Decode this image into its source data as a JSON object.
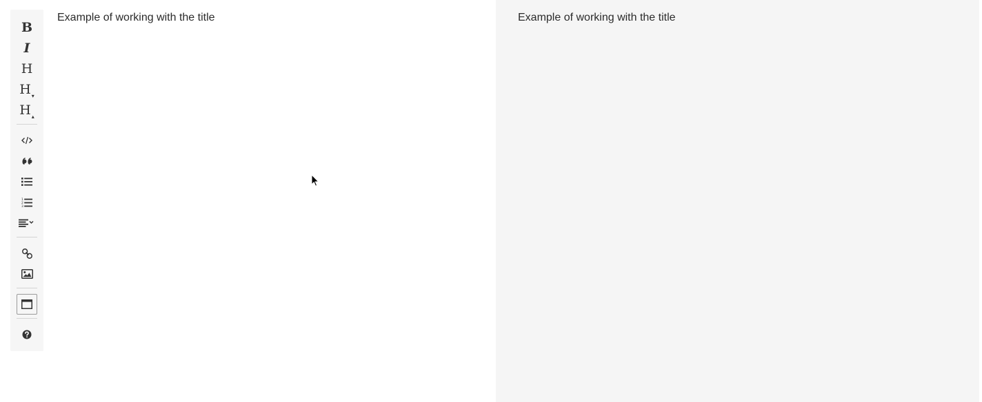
{
  "toolbar": {
    "bold": {
      "label": "B",
      "icon": "bold-icon"
    },
    "italic": {
      "label": "I",
      "icon": "italic-icon"
    },
    "heading": {
      "label": "H",
      "icon": "heading-icon"
    },
    "heading_smaller": {
      "label": "H",
      "suffix": "▾",
      "icon": "heading-smaller-icon"
    },
    "heading_bigger": {
      "label": "H",
      "suffix": "▴",
      "icon": "heading-bigger-icon"
    },
    "code": {
      "icon": "code-icon"
    },
    "quote": {
      "icon": "quote-icon"
    },
    "unordered_list": {
      "icon": "unordered-list-icon"
    },
    "ordered_list": {
      "icon": "ordered-list-icon"
    },
    "align": {
      "icon": "align-dropdown-icon"
    },
    "link": {
      "icon": "link-icon"
    },
    "image": {
      "icon": "image-icon"
    },
    "side_by_side": {
      "icon": "side-by-side-icon",
      "active": true
    },
    "help": {
      "icon": "help-icon"
    }
  },
  "editor": {
    "content": "Example of working with the title"
  },
  "preview": {
    "content": "Example of working with the title"
  },
  "colors": {
    "toolbar_bg": "#f6f6f6",
    "editor_bg": "#ffffff",
    "preview_bg": "#f5f5f5",
    "text": "#2b2b2b",
    "icon": "#333333"
  }
}
